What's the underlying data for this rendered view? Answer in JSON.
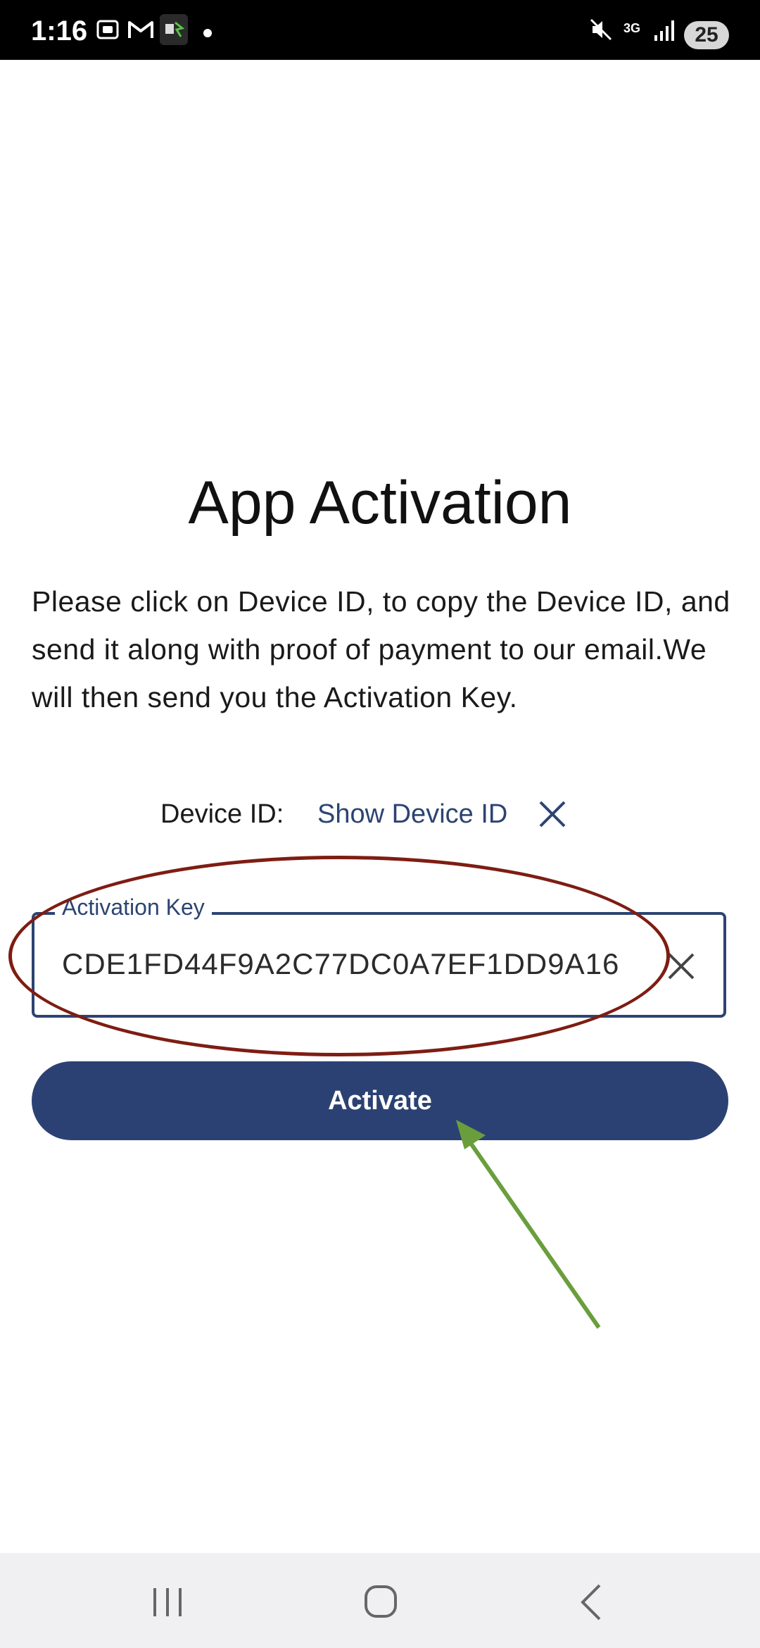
{
  "status_bar": {
    "time": "1:16",
    "network": "3G",
    "battery": "25",
    "icons": [
      "screenshot-icon",
      "gmail-icon",
      "app-notification-icon",
      "dot-icon",
      "mute-icon",
      "network-3g-icon",
      "signal-icon",
      "battery-icon"
    ]
  },
  "activation": {
    "title": "App Activation",
    "description": "Please click on Device ID, to copy the Device ID, and send it along with proof of payment to our email.We will then send you the Activation Key.",
    "device_id_label": "Device ID:",
    "device_id_link": "Show Device ID",
    "key_label": "Activation Key",
    "key_value": "CDE1FD44F9A2C77DC0A7EF1DD9A16",
    "activate_label": "Activate"
  },
  "colors": {
    "primary": "#2c4173",
    "link": "#2c4472",
    "annotation_ellipse": "#7e1d12",
    "annotation_arrow": "#6a9e3c",
    "nav_background": "#f0f0f2"
  },
  "nav_bar": {
    "icons": [
      "recent-apps-icon",
      "home-icon",
      "back-icon"
    ]
  }
}
